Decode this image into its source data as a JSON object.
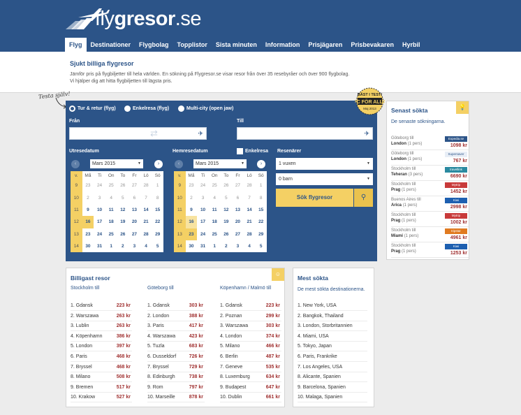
{
  "header": {
    "logo_prefix": "fly",
    "logo_mid": "gresor",
    "logo_suffix": ".se",
    "nav": [
      "Flyg",
      "Destinationer",
      "Flygbolag",
      "Topplistor",
      "Sista minuten",
      "Information",
      "Prisjägaren",
      "Prisbevakaren",
      "Hyrbil"
    ],
    "active_nav": "Flyg"
  },
  "intro": {
    "title": "Sjukt billiga flygresor",
    "line1": "Jämför pris på flygbiljetter till hela världen. En sökning på Flygresor.se visar resor från över 35 resebyråer och över 900 flygbolag.",
    "line2": "Vi hjälper dig att hitta flygbiljetten till lägsta pris."
  },
  "testa": "Testa själv!",
  "badge": {
    "line1": "BÄST I TEST!",
    "line2": "PC FÖR ALLA",
    "line3": "Maj 2013"
  },
  "search": {
    "radio_return": "Tur & retur (flyg)",
    "radio_oneway": "Enkelresa (flyg)",
    "radio_multi": "Multi-city (open jaw)",
    "from_label": "Från",
    "to_label": "Till",
    "out_label": "Utresedatum",
    "home_label": "Hemresedatum",
    "oneway_check": "Enkelresa",
    "travelers_label": "Resenärer",
    "adults": "1 vuxen",
    "children": "0 barn",
    "submit": "Sök flygresor",
    "month_out": "Mars 2015",
    "month_home": "Mars 2015"
  },
  "calendar": {
    "headers": [
      "v.",
      "Må",
      "Ti",
      "On",
      "To",
      "Fr",
      "Lö",
      "Sö"
    ],
    "weeks": [
      [
        "9",
        "23",
        "24",
        "25",
        "26",
        "27",
        "28",
        "1"
      ],
      [
        "10",
        "2",
        "3",
        "4",
        "5",
        "6",
        "7",
        "8"
      ],
      [
        "11",
        "9",
        "10",
        "11",
        "12",
        "13",
        "14",
        "15"
      ],
      [
        "12",
        "16",
        "17",
        "18",
        "19",
        "20",
        "21",
        "22"
      ],
      [
        "13",
        "23",
        "24",
        "25",
        "26",
        "27",
        "28",
        "29"
      ],
      [
        "14",
        "30",
        "31",
        "1",
        "2",
        "3",
        "4",
        "5"
      ]
    ]
  },
  "senast": {
    "title": "Senast sökta",
    "subtitle": "De senaste sökningarna.",
    "rows": [
      {
        "from": "Göteborg till",
        "to": "London",
        "pers": "(1 pers)",
        "price": "1098 kr",
        "logo": "Expedia.se",
        "color": "#2c5488"
      },
      {
        "from": "Göteborg till",
        "to": "London",
        "pers": "(1 pers)",
        "price": "767 kr",
        "logo": "Supersaver",
        "color": "#e8eef6"
      },
      {
        "from": "Stockholm till",
        "to": "Teheran",
        "pers": "(3 pers)",
        "price": "6690 kr",
        "logo": "travellink",
        "color": "#2a8aa0"
      },
      {
        "from": "Stockholm till",
        "to": "Prag",
        "pers": "(1 pers)",
        "price": "1452 kr",
        "logo": "Mytrip",
        "color": "#c83a3a"
      },
      {
        "from": "Buenos Aires till",
        "to": "Arica",
        "pers": "(1 pers)",
        "price": "2998 kr",
        "logo": "Kiwi",
        "color": "#1d5fb0"
      },
      {
        "from": "Stockholm till",
        "to": "Prag",
        "pers": "(1 pers)",
        "price": "1002 kr",
        "logo": "Mytrip",
        "color": "#c83a3a"
      },
      {
        "from": "Stockholm till",
        "to": "Miami",
        "pers": "(1 pers)",
        "price": "4961 kr",
        "logo": "tripstar",
        "color": "#e07a20"
      },
      {
        "from": "Stockholm till",
        "to": "Prag",
        "pers": "(1 pers)",
        "price": "1253 kr",
        "logo": "Kiwi",
        "color": "#1d5fb0"
      }
    ]
  },
  "billigast": {
    "title": "Billigast resor",
    "columns": [
      {
        "head": "Stockholm till",
        "rows": [
          [
            "1. Gdansk",
            "223 kr"
          ],
          [
            "2. Warszawa",
            "263 kr"
          ],
          [
            "3. Lublin",
            "263 kr"
          ],
          [
            "4. Köpenhamn",
            "386 kr"
          ],
          [
            "5. London",
            "397 kr"
          ],
          [
            "6. Paris",
            "468 kr"
          ],
          [
            "7. Bryssel",
            "468 kr"
          ],
          [
            "8. Milano",
            "508 kr"
          ],
          [
            "9. Bremen",
            "517 kr"
          ],
          [
            "10. Krakow",
            "527 kr"
          ]
        ]
      },
      {
        "head": "Göteborg till",
        "rows": [
          [
            "1. Gdansk",
            "303 kr"
          ],
          [
            "2. London",
            "388 kr"
          ],
          [
            "3. Paris",
            "417 kr"
          ],
          [
            "4. Warszawa",
            "423 kr"
          ],
          [
            "5. Tuzla",
            "683 kr"
          ],
          [
            "6. Dusseldorf",
            "726 kr"
          ],
          [
            "7. Bryssel",
            "729 kr"
          ],
          [
            "8. Edinburgh",
            "738 kr"
          ],
          [
            "9. Rom",
            "797 kr"
          ],
          [
            "10. Marseille",
            "878 kr"
          ]
        ]
      },
      {
        "head": "Köpenhamn / Malmö till",
        "rows": [
          [
            "1. Gdansk",
            "223 kr"
          ],
          [
            "2. Poznan",
            "299 kr"
          ],
          [
            "3. Warszawa",
            "303 kr"
          ],
          [
            "4. London",
            "374 kr"
          ],
          [
            "5. Milano",
            "466 kr"
          ],
          [
            "6. Berlin",
            "487 kr"
          ],
          [
            "7. Geneve",
            "535 kr"
          ],
          [
            "8. Luxemburg",
            "634 kr"
          ],
          [
            "9. Budapest",
            "647 kr"
          ],
          [
            "10. Dublin",
            "661 kr"
          ]
        ]
      }
    ]
  },
  "mest": {
    "title": "Mest sökta",
    "subtitle": "De mest sökta destinationerna.",
    "rows": [
      "1. New York, USA",
      "2. Bangkok, Thailand",
      "3. London, Storbritannien",
      "4. Miami, USA",
      "5. Tokyo, Japan",
      "6. Paris, Frankrike",
      "7. Los Angeles, USA",
      "8. Alicante, Spanien",
      "9. Barcelona, Spanien",
      "10. Malaga, Spanien"
    ]
  }
}
